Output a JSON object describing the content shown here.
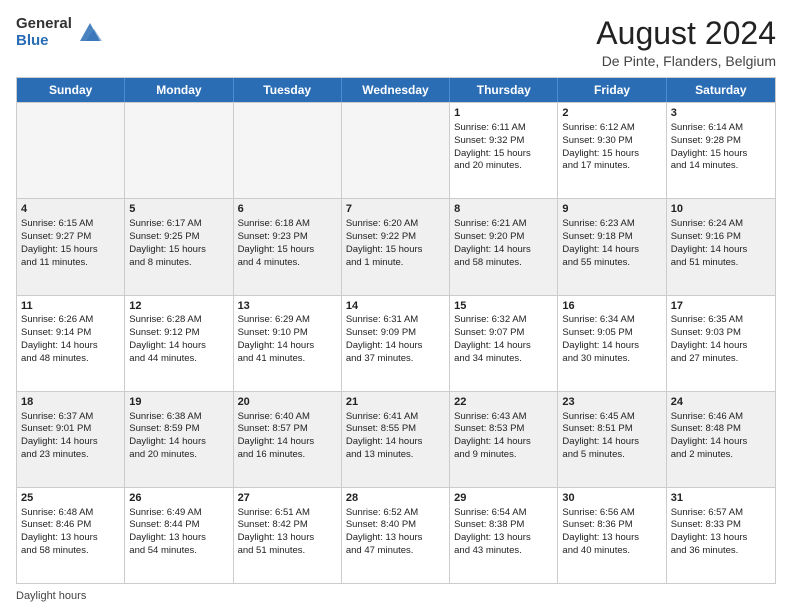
{
  "logo": {
    "general": "General",
    "blue": "Blue"
  },
  "title": {
    "month": "August 2024",
    "location": "De Pinte, Flanders, Belgium"
  },
  "weekdays": [
    "Sunday",
    "Monday",
    "Tuesday",
    "Wednesday",
    "Thursday",
    "Friday",
    "Saturday"
  ],
  "footer": "Daylight hours",
  "weeks": [
    [
      {
        "day": "",
        "info": "",
        "empty": true
      },
      {
        "day": "",
        "info": "",
        "empty": true
      },
      {
        "day": "",
        "info": "",
        "empty": true
      },
      {
        "day": "",
        "info": "",
        "empty": true
      },
      {
        "day": "1",
        "info": "Sunrise: 6:11 AM\nSunset: 9:32 PM\nDaylight: 15 hours\nand 20 minutes."
      },
      {
        "day": "2",
        "info": "Sunrise: 6:12 AM\nSunset: 9:30 PM\nDaylight: 15 hours\nand 17 minutes."
      },
      {
        "day": "3",
        "info": "Sunrise: 6:14 AM\nSunset: 9:28 PM\nDaylight: 15 hours\nand 14 minutes."
      }
    ],
    [
      {
        "day": "4",
        "info": "Sunrise: 6:15 AM\nSunset: 9:27 PM\nDaylight: 15 hours\nand 11 minutes.",
        "shaded": true
      },
      {
        "day": "5",
        "info": "Sunrise: 6:17 AM\nSunset: 9:25 PM\nDaylight: 15 hours\nand 8 minutes.",
        "shaded": true
      },
      {
        "day": "6",
        "info": "Sunrise: 6:18 AM\nSunset: 9:23 PM\nDaylight: 15 hours\nand 4 minutes.",
        "shaded": true
      },
      {
        "day": "7",
        "info": "Sunrise: 6:20 AM\nSunset: 9:22 PM\nDaylight: 15 hours\nand 1 minute.",
        "shaded": true
      },
      {
        "day": "8",
        "info": "Sunrise: 6:21 AM\nSunset: 9:20 PM\nDaylight: 14 hours\nand 58 minutes.",
        "shaded": true
      },
      {
        "day": "9",
        "info": "Sunrise: 6:23 AM\nSunset: 9:18 PM\nDaylight: 14 hours\nand 55 minutes.",
        "shaded": true
      },
      {
        "day": "10",
        "info": "Sunrise: 6:24 AM\nSunset: 9:16 PM\nDaylight: 14 hours\nand 51 minutes.",
        "shaded": true
      }
    ],
    [
      {
        "day": "11",
        "info": "Sunrise: 6:26 AM\nSunset: 9:14 PM\nDaylight: 14 hours\nand 48 minutes."
      },
      {
        "day": "12",
        "info": "Sunrise: 6:28 AM\nSunset: 9:12 PM\nDaylight: 14 hours\nand 44 minutes."
      },
      {
        "day": "13",
        "info": "Sunrise: 6:29 AM\nSunset: 9:10 PM\nDaylight: 14 hours\nand 41 minutes."
      },
      {
        "day": "14",
        "info": "Sunrise: 6:31 AM\nSunset: 9:09 PM\nDaylight: 14 hours\nand 37 minutes."
      },
      {
        "day": "15",
        "info": "Sunrise: 6:32 AM\nSunset: 9:07 PM\nDaylight: 14 hours\nand 34 minutes."
      },
      {
        "day": "16",
        "info": "Sunrise: 6:34 AM\nSunset: 9:05 PM\nDaylight: 14 hours\nand 30 minutes."
      },
      {
        "day": "17",
        "info": "Sunrise: 6:35 AM\nSunset: 9:03 PM\nDaylight: 14 hours\nand 27 minutes."
      }
    ],
    [
      {
        "day": "18",
        "info": "Sunrise: 6:37 AM\nSunset: 9:01 PM\nDaylight: 14 hours\nand 23 minutes.",
        "shaded": true
      },
      {
        "day": "19",
        "info": "Sunrise: 6:38 AM\nSunset: 8:59 PM\nDaylight: 14 hours\nand 20 minutes.",
        "shaded": true
      },
      {
        "day": "20",
        "info": "Sunrise: 6:40 AM\nSunset: 8:57 PM\nDaylight: 14 hours\nand 16 minutes.",
        "shaded": true
      },
      {
        "day": "21",
        "info": "Sunrise: 6:41 AM\nSunset: 8:55 PM\nDaylight: 14 hours\nand 13 minutes.",
        "shaded": true
      },
      {
        "day": "22",
        "info": "Sunrise: 6:43 AM\nSunset: 8:53 PM\nDaylight: 14 hours\nand 9 minutes.",
        "shaded": true
      },
      {
        "day": "23",
        "info": "Sunrise: 6:45 AM\nSunset: 8:51 PM\nDaylight: 14 hours\nand 5 minutes.",
        "shaded": true
      },
      {
        "day": "24",
        "info": "Sunrise: 6:46 AM\nSunset: 8:48 PM\nDaylight: 14 hours\nand 2 minutes.",
        "shaded": true
      }
    ],
    [
      {
        "day": "25",
        "info": "Sunrise: 6:48 AM\nSunset: 8:46 PM\nDaylight: 13 hours\nand 58 minutes."
      },
      {
        "day": "26",
        "info": "Sunrise: 6:49 AM\nSunset: 8:44 PM\nDaylight: 13 hours\nand 54 minutes."
      },
      {
        "day": "27",
        "info": "Sunrise: 6:51 AM\nSunset: 8:42 PM\nDaylight: 13 hours\nand 51 minutes."
      },
      {
        "day": "28",
        "info": "Sunrise: 6:52 AM\nSunset: 8:40 PM\nDaylight: 13 hours\nand 47 minutes."
      },
      {
        "day": "29",
        "info": "Sunrise: 6:54 AM\nSunset: 8:38 PM\nDaylight: 13 hours\nand 43 minutes."
      },
      {
        "day": "30",
        "info": "Sunrise: 6:56 AM\nSunset: 8:36 PM\nDaylight: 13 hours\nand 40 minutes."
      },
      {
        "day": "31",
        "info": "Sunrise: 6:57 AM\nSunset: 8:33 PM\nDaylight: 13 hours\nand 36 minutes."
      }
    ]
  ]
}
